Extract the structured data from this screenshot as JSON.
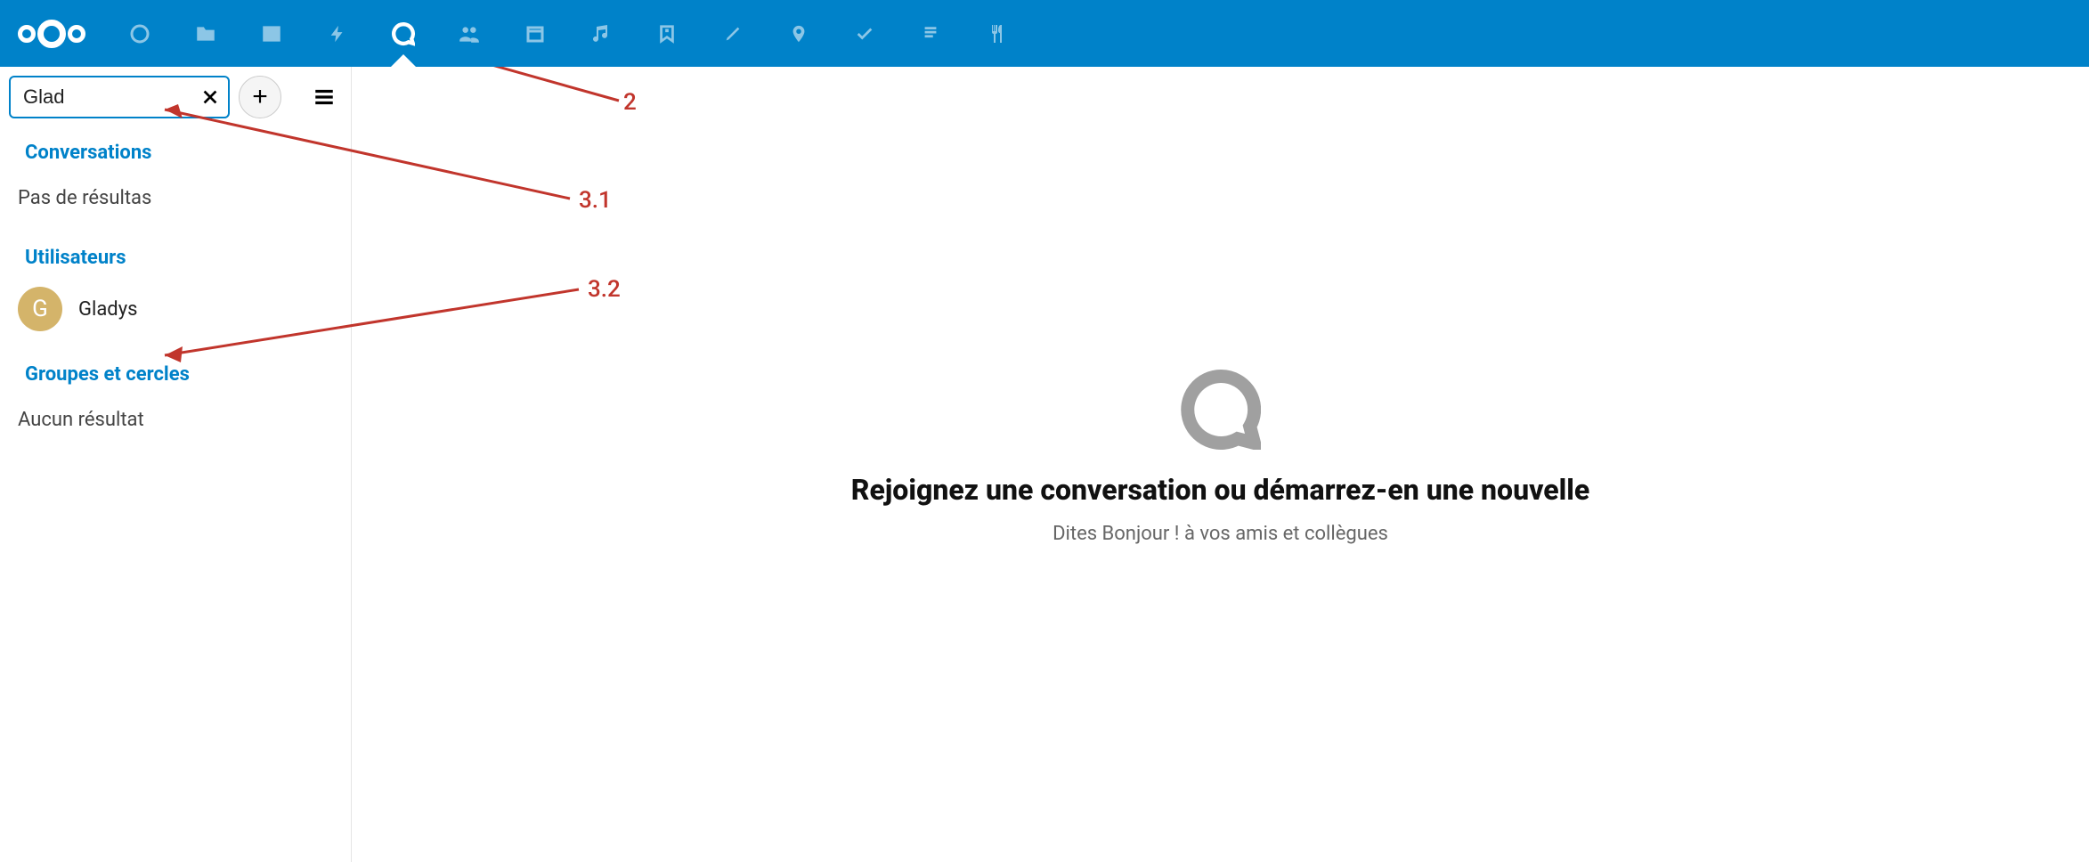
{
  "nav": {
    "icons": [
      "dashboard",
      "files",
      "photos",
      "activity",
      "talk",
      "contacts",
      "calendar",
      "music",
      "notes-alt",
      "deck",
      "maps",
      "tasks",
      "news",
      "food"
    ],
    "active": "talk"
  },
  "sidebar": {
    "search": {
      "value": "Glad",
      "placeholder": ""
    },
    "sections": {
      "conversations": {
        "title": "Conversations",
        "empty": "Pas de résultas"
      },
      "users": {
        "title": "Utilisateurs",
        "items": [
          {
            "initial": "G",
            "name": "Gladys"
          }
        ]
      },
      "groups": {
        "title": "Groupes et cercles",
        "empty": "Aucun résultat"
      }
    }
  },
  "main": {
    "heading": "Rejoignez une conversation ou démarrez-en une nouvelle",
    "subheading": "Dites Bonjour ! à vos amis et collègues"
  },
  "annotations": {
    "a2": "2",
    "a31": "3.1",
    "a32": "3.2"
  }
}
